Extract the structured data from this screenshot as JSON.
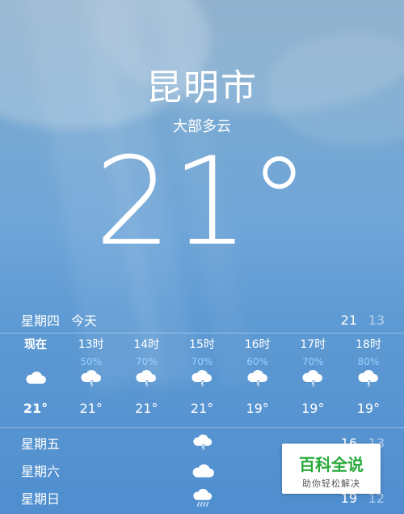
{
  "header": {
    "city": "昆明市",
    "condition": "大部多云",
    "temperature": "21"
  },
  "today": {
    "day": "星期四",
    "label": "今天",
    "high": "21",
    "low": "13"
  },
  "hourly": [
    {
      "time": "现在",
      "precip": "",
      "icon": "cloud-icon",
      "temp": "21°"
    },
    {
      "time": "13时",
      "precip": "50%",
      "icon": "thunderstorm-icon",
      "temp": "21°"
    },
    {
      "time": "14时",
      "precip": "70%",
      "icon": "thunderstorm-icon",
      "temp": "21°"
    },
    {
      "time": "15时",
      "precip": "70%",
      "icon": "thunderstorm-icon",
      "temp": "21°"
    },
    {
      "time": "16时",
      "precip": "60%",
      "icon": "thunderstorm-icon",
      "temp": "19°"
    },
    {
      "time": "17时",
      "precip": "70%",
      "icon": "thunderstorm-icon",
      "temp": "19°"
    },
    {
      "time": "18时",
      "precip": "80%",
      "icon": "thunderstorm-icon",
      "temp": "19°"
    }
  ],
  "weekly": [
    {
      "day": "星期五",
      "icon": "thunderstorm-icon",
      "high": "16",
      "low": "13"
    },
    {
      "day": "星期六",
      "icon": "cloud-icon",
      "high": "",
      "low": ""
    },
    {
      "day": "星期日",
      "icon": "rain-icon",
      "high": "19",
      "low": "12"
    }
  ],
  "watermark": {
    "title": "百科全说",
    "subtitle": "助你轻松解决"
  },
  "colors": {
    "precip": "#9bd0ff",
    "watermark_green": "#29a93a"
  }
}
